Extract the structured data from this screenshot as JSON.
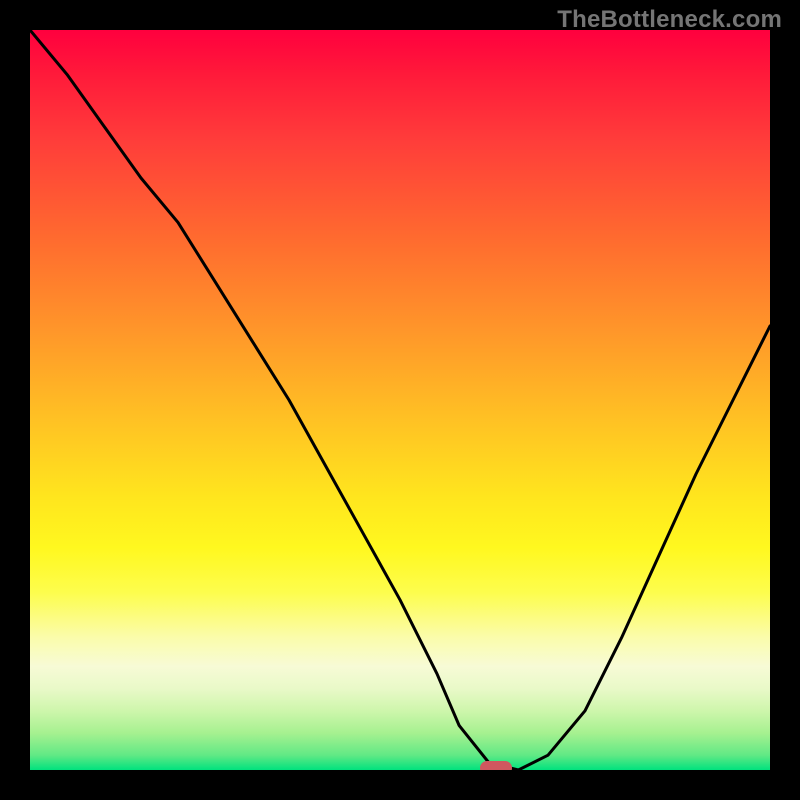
{
  "watermark": {
    "text": "TheBottleneck.com"
  },
  "colors": {
    "frame_bg": "#000000",
    "curve": "#000000",
    "marker": "#d0575f",
    "watermark": "#757575"
  },
  "chart_data": {
    "type": "line",
    "title": "",
    "xlabel": "",
    "ylabel": "",
    "xlim": [
      0,
      100
    ],
    "ylim": [
      0,
      100
    ],
    "x": [
      0,
      5,
      10,
      15,
      20,
      25,
      30,
      35,
      40,
      45,
      50,
      55,
      58,
      62,
      66,
      70,
      75,
      80,
      85,
      90,
      95,
      100
    ],
    "values": [
      100,
      94,
      87,
      80,
      74,
      66,
      58,
      50,
      41,
      32,
      23,
      13,
      6,
      1,
      0,
      2,
      8,
      18,
      29,
      40,
      50,
      60
    ],
    "marker": {
      "x": 63,
      "y": 0
    },
    "grid": false,
    "legend": false
  }
}
